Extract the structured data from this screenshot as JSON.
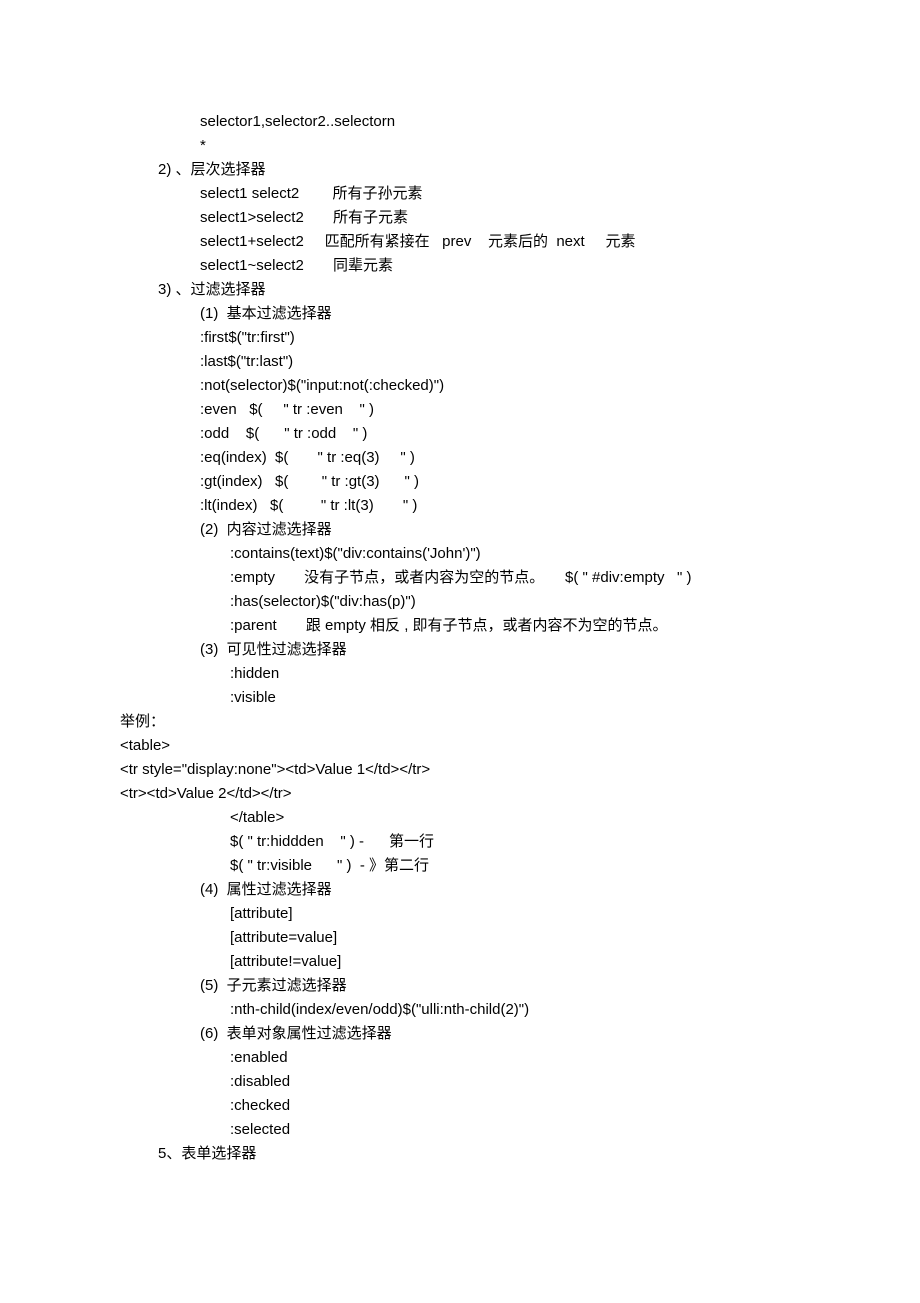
{
  "lines": [
    {
      "cls": "indent1",
      "text": "selector1,selector2..selectorn"
    },
    {
      "cls": "indent1",
      "text": "*"
    },
    {
      "cls": "indent0a",
      "text": "2) 、层次选择器"
    },
    {
      "cls": "indent1",
      "text": "select1 select2        所有子孙元素"
    },
    {
      "cls": "indent1",
      "text": "select1>select2       所有子元素"
    },
    {
      "cls": "indent1",
      "text": "select1+select2     匹配所有紧接在   prev    元素后的  next     元素"
    },
    {
      "cls": "indent1",
      "text": "select1~select2       同辈元素"
    },
    {
      "cls": "indent0a",
      "text": "3) 、过滤选择器"
    },
    {
      "cls": "indent1",
      "text": "(1)  基本过滤选择器"
    },
    {
      "cls": "indent1",
      "text": ":first$(\"tr:first\")"
    },
    {
      "cls": "indent1",
      "text": ":last$(\"tr:last\")"
    },
    {
      "cls": "indent1",
      "text": ":not(selector)$(\"input:not(:checked)\")"
    },
    {
      "cls": "indent1",
      "text": ":even   $(     \" tr :even    \" )"
    },
    {
      "cls": "indent1",
      "text": ":odd    $(      \" tr :odd    \" )"
    },
    {
      "cls": "indent1",
      "text": ":eq(index)  $(       \" tr :eq(3)     \" )"
    },
    {
      "cls": "indent1",
      "text": ":gt(index)   $(        \" tr :gt(3)      \" )"
    },
    {
      "cls": "indent1",
      "text": ":lt(index)   $(         \" tr :lt(3)       \" )"
    },
    {
      "cls": "indent1",
      "text": "(2)  内容过滤选择器"
    },
    {
      "cls": "indent3",
      "text": ":contains(text)$(\"div:contains('John')\")"
    },
    {
      "cls": "indent3",
      "text": ":empty       没有子节点，或者内容为空的节点。     $( \" #div:empty   \" )"
    },
    {
      "cls": "indent3",
      "text": ":has(selector)$(\"div:has(p)\")"
    },
    {
      "cls": "indent3",
      "text": ":parent       跟 empty 相反 , 即有子节点，或者内容不为空的节点。"
    },
    {
      "cls": "indent1",
      "text": "(3)  可见性过滤选择器"
    },
    {
      "cls": "indent3",
      "text": ":hidden"
    },
    {
      "cls": "indent3",
      "text": ":visible"
    },
    {
      "cls": "root",
      "text": "举例："
    },
    {
      "cls": "root",
      "text": "<table>"
    },
    {
      "cls": "root",
      "text": "<tr style=\"display:none\"><td>Value 1</td></tr>"
    },
    {
      "cls": "root",
      "text": "<tr><td>Value 2</td></tr>"
    },
    {
      "cls": "indent3",
      "text": "</table>"
    },
    {
      "cls": "indent3",
      "text": "$( \" tr:hiddden    \" ) -      第一行"
    },
    {
      "cls": "indent3",
      "text": "$( \" tr:visible      \" )  - 》第二行"
    },
    {
      "cls": "indent1",
      "text": "(4)  属性过滤选择器"
    },
    {
      "cls": "indent3",
      "text": "[attribute]"
    },
    {
      "cls": "indent3",
      "text": "[attribute=value]"
    },
    {
      "cls": "indent3",
      "text": "[attribute!=value]"
    },
    {
      "cls": "indent1",
      "text": "(5)  子元素过滤选择器"
    },
    {
      "cls": "indent3",
      "text": ":nth-child(index/even/odd)$(\"ulli:nth-child(2)\")"
    },
    {
      "cls": "indent1",
      "text": "(6)  表单对象属性过滤选择器"
    },
    {
      "cls": "indent3",
      "text": ":enabled"
    },
    {
      "cls": "indent3",
      "text": ":disabled"
    },
    {
      "cls": "indent3",
      "text": ":checked"
    },
    {
      "cls": "indent3",
      "text": ":selected"
    },
    {
      "cls": "indent0a",
      "text": "5、表单选择器"
    }
  ]
}
